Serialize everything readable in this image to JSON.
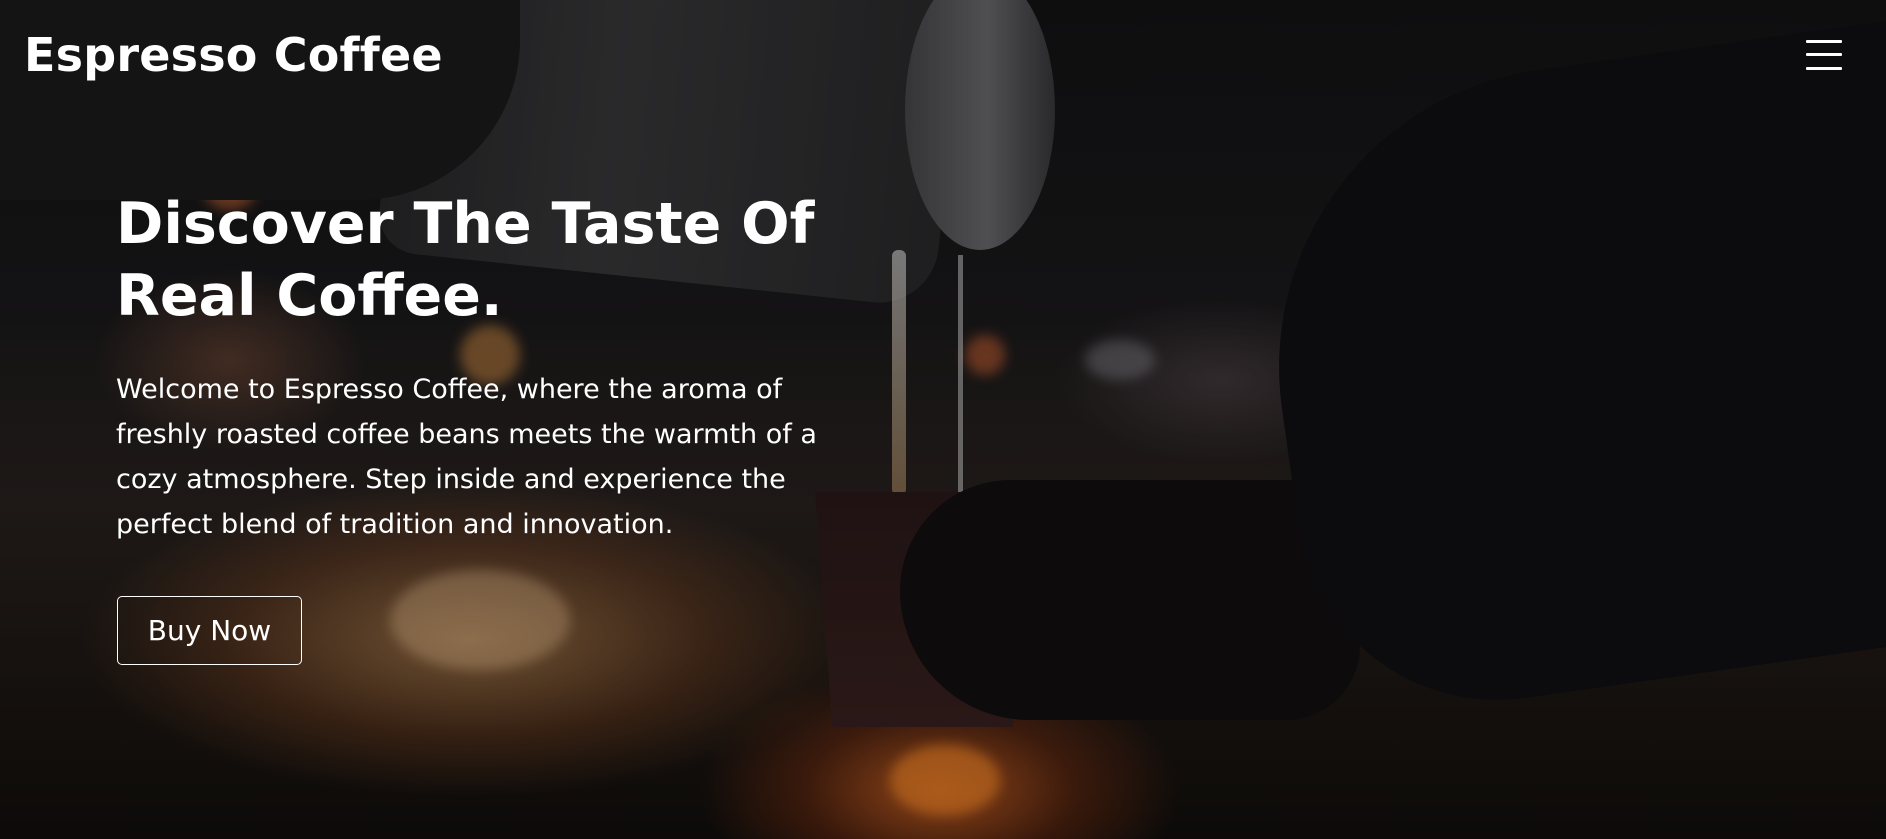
{
  "header": {
    "brand": "Espresso Coffee",
    "menu_icon": "hamburger-menu-icon"
  },
  "hero": {
    "headline_line1": "Discover The Taste Of",
    "headline_line2": "Real Coffee.",
    "intro_lines": [
      "Welcome to Espresso Coffee, where the aroma of",
      "freshly roasted coffee beans meets the warmth of a",
      "cozy atmosphere. Step inside and experience the",
      "perfect blend of tradition and innovation."
    ],
    "cta_label": "Buy Now"
  },
  "colors": {
    "text": "#ffffff",
    "button_border": "#ffffff",
    "background_dark": "#0b0b0d",
    "fire_glow": "#e07a38"
  }
}
